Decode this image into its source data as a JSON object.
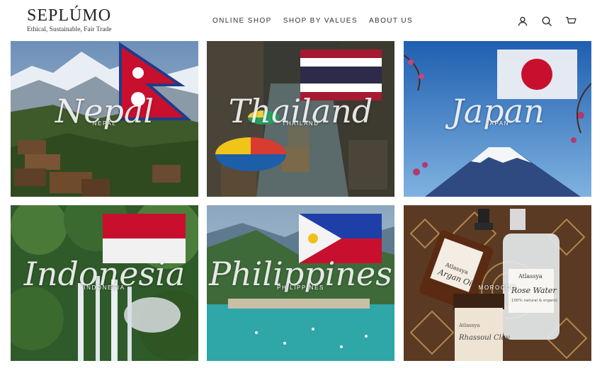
{
  "brand": {
    "name": "SEPLÚMO",
    "tagline": "Ethical, Sustainable, Fair Trade"
  },
  "nav": [
    {
      "label": "ONLINE SHOP"
    },
    {
      "label": "SHOP BY VALUES"
    },
    {
      "label": "ABOUT US"
    }
  ],
  "icons": {
    "account": "user-icon",
    "search": "search-icon",
    "cart": "cart-icon"
  },
  "tiles": [
    {
      "script": "Nepal",
      "caption": "NEPAL"
    },
    {
      "script": "Thailand",
      "caption": "THAILAND"
    },
    {
      "script": "Japan",
      "caption": "JAPAN"
    },
    {
      "script": "Indonesia",
      "caption": "INDONESIA"
    },
    {
      "script": "Philippines",
      "caption": "PHILIPPINES"
    },
    {
      "script": "",
      "caption": "MOROCCO"
    }
  ],
  "products": {
    "bottle1": "Argan Oil",
    "bottle2": "Rose Water",
    "bottle2_sub": "100% natural & organic",
    "jar": "Rhassoul Clay",
    "maker": "Atlassya"
  }
}
